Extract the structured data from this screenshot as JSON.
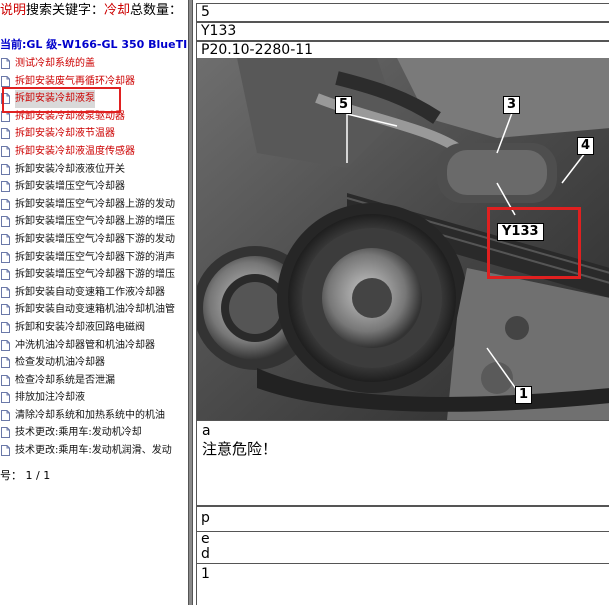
{
  "search": {
    "label_a": "说明",
    "label_b": "搜索关键字：",
    "keyword": "冷却",
    "count_label": "总数量："
  },
  "vehicle": "当前:GL 级-W166-GL 350 BlueTI",
  "list": [
    {
      "label": "测试冷却系统的盖",
      "color": "red"
    },
    {
      "label": "拆卸安装废气再循环冷却器",
      "color": "red"
    },
    {
      "label": "拆卸安装冷却液泵",
      "color": "red",
      "selected": true
    },
    {
      "label": "拆卸安装冷却液泵驱动器",
      "color": "red"
    },
    {
      "label": "拆卸安装冷却液节温器",
      "color": "red"
    },
    {
      "label": "拆卸安装冷却液温度传感器",
      "color": "red"
    },
    {
      "label": "拆卸安装冷却液液位开关",
      "color": "black"
    },
    {
      "label": "拆卸安装增压空气冷却器",
      "color": "black"
    },
    {
      "label": "拆卸安装增压空气冷却器上游的发动",
      "color": "black"
    },
    {
      "label": "拆卸安装增压空气冷却器上游的增压",
      "color": "black"
    },
    {
      "label": "拆卸安装增压空气冷却器下游的发动",
      "color": "black"
    },
    {
      "label": "拆卸安装增压空气冷却器下游的消声",
      "color": "black"
    },
    {
      "label": "拆卸安装增压空气冷却器下游的增压",
      "color": "black"
    },
    {
      "label": "拆卸安装自动变速箱工作液冷却器",
      "color": "black"
    },
    {
      "label": "拆卸安装自动变速箱机油冷却机油管",
      "color": "black"
    },
    {
      "label": "拆卸和安装冷却液回路电磁阀",
      "color": "black"
    },
    {
      "label": "冲洗机油冷却器管和机油冷却器",
      "color": "black"
    },
    {
      "label": "检查发动机油冷却器",
      "color": "black"
    },
    {
      "label": "检查冷却系统是否泄漏",
      "color": "black"
    },
    {
      "label": "排放加注冷却液",
      "color": "black"
    },
    {
      "label": "清除冷却系统和加热系统中的机油",
      "color": "black"
    },
    {
      "label": "技术更改:乘用车:发动机冷却",
      "color": "black"
    },
    {
      "label": "技术更改:乘用车:发动机润滑、发动",
      "color": "black"
    }
  ],
  "pager": "号：  1 / 1",
  "detail": {
    "r1": "5",
    "r2": "Y133",
    "r3": "P20.10-2280-11",
    "callouts": [
      "1",
      "3",
      "4",
      "5"
    ],
    "figure_label": "Y133",
    "note_letter": "a",
    "note_text": "注意危险！",
    "p": "p",
    "e": "e",
    "d": "d",
    "last": "1"
  },
  "colors": {
    "highlight": "#e02020",
    "red_text": "#cc0000",
    "vehicle_blue": "#0000cc"
  }
}
